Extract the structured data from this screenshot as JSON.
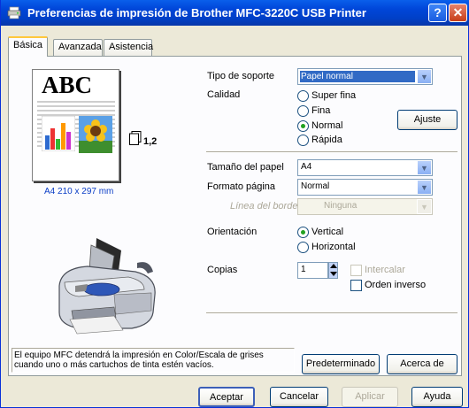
{
  "window": {
    "title": "Preferencias de impresión de Brother MFC-3220C USB Printer",
    "help_glyph": "?",
    "close_glyph": "✕"
  },
  "tabs": [
    {
      "label": "Básica"
    },
    {
      "label": "Avanzada"
    },
    {
      "label": "Asistencia"
    }
  ],
  "preview": {
    "abc_text": "ABC",
    "pages_label": "1,2",
    "paper_size_text": "A4 210 x 297 mm"
  },
  "media_type": {
    "label": "Tipo de soporte",
    "value": "Papel normal"
  },
  "quality": {
    "label": "Calidad",
    "options": [
      "Super fina",
      "Fina",
      "Normal",
      "Rápida"
    ],
    "selected": "Normal",
    "adjust_button": "Ajuste"
  },
  "paper_size": {
    "label": "Tamaño del papel",
    "value": "A4"
  },
  "page_format": {
    "label": "Formato página",
    "value": "Normal"
  },
  "border_line": {
    "label": "Línea del borde",
    "value": "Ninguna"
  },
  "orientation": {
    "label": "Orientación",
    "options": [
      "Vertical",
      "Horizontal"
    ],
    "selected": "Vertical"
  },
  "copies": {
    "label": "Copias",
    "value": "1",
    "collate_label": "Intercalar",
    "reverse_order_label": "Orden inverso"
  },
  "info_text": {
    "line1": "El equipo MFC detendrá la impresión en Color/Escala de grises",
    "line2": "cuando uno o más cartuchos de tinta estén vacíos."
  },
  "buttons": {
    "default": "Predeterminado",
    "about": "Acerca de",
    "ok": "Aceptar",
    "cancel": "Cancelar",
    "apply": "Aplicar",
    "help": "Ayuda"
  },
  "colors": {
    "title_bar": "#0046D9",
    "selection": "#316AC5",
    "radio_dot": "#21A121",
    "face": "#ECE9D8"
  }
}
